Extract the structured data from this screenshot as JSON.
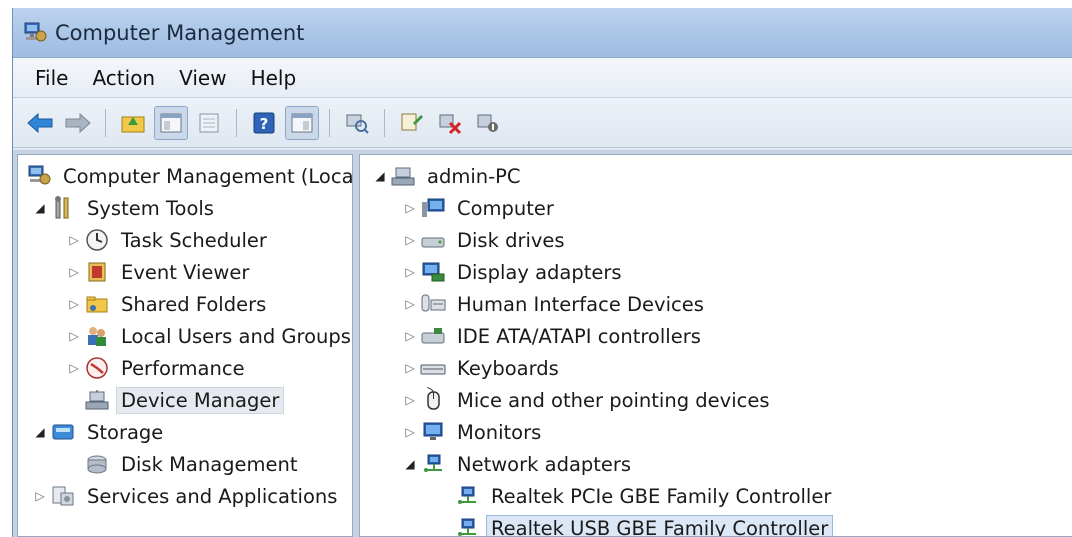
{
  "window": {
    "title": "Computer Management"
  },
  "menu": [
    "File",
    "Action",
    "View",
    "Help"
  ],
  "left_tree": {
    "root": "Computer Management (Local",
    "system_tools": "System Tools",
    "task_scheduler": "Task Scheduler",
    "event_viewer": "Event Viewer",
    "shared_folders": "Shared Folders",
    "local_users": "Local Users and Groups",
    "performance": "Performance",
    "device_manager": "Device Manager",
    "storage": "Storage",
    "disk_management": "Disk Management",
    "services": "Services and Applications"
  },
  "right_tree": {
    "root": "admin-PC",
    "computer": "Computer",
    "disk_drives": "Disk drives",
    "display_adapters": "Display adapters",
    "hid": "Human Interface Devices",
    "ide": "IDE ATA/ATAPI controllers",
    "keyboards": "Keyboards",
    "mice": "Mice and other pointing devices",
    "monitors": "Monitors",
    "network_adapters": "Network adapters",
    "realtek_pcie": "Realtek PCIe GBE Family Controller",
    "realtek_usb": "Realtek USB GBE Family Controller"
  }
}
